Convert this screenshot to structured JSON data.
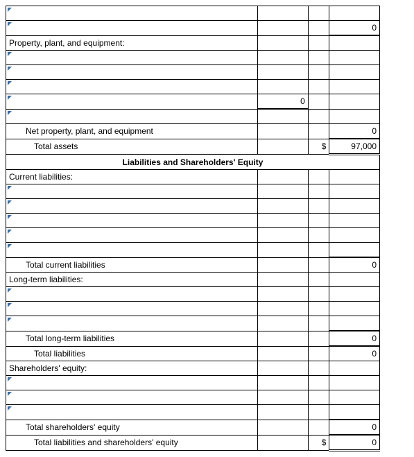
{
  "ppe_label": "Property, plant, and equipment:",
  "net_ppe_label": "Net property, plant, and equipment",
  "total_assets_label": "Total assets",
  "liab_se_header": "Liabilities and Shareholders' Equity",
  "current_liab_label": "Current liabilities:",
  "total_current_liab_label": "Total current liabilities",
  "lt_liab_label": "Long-term liabilities:",
  "total_lt_liab_label": "Total long-term liabilities",
  "total_liab_label": "Total liabilities",
  "se_label": "Shareholders' equity:",
  "total_se_label": "Total shareholders' equity",
  "total_liab_se_label": "Total liabilities and shareholders' equity",
  "currency": "$",
  "zero": "0",
  "total_assets_val": "97,000"
}
